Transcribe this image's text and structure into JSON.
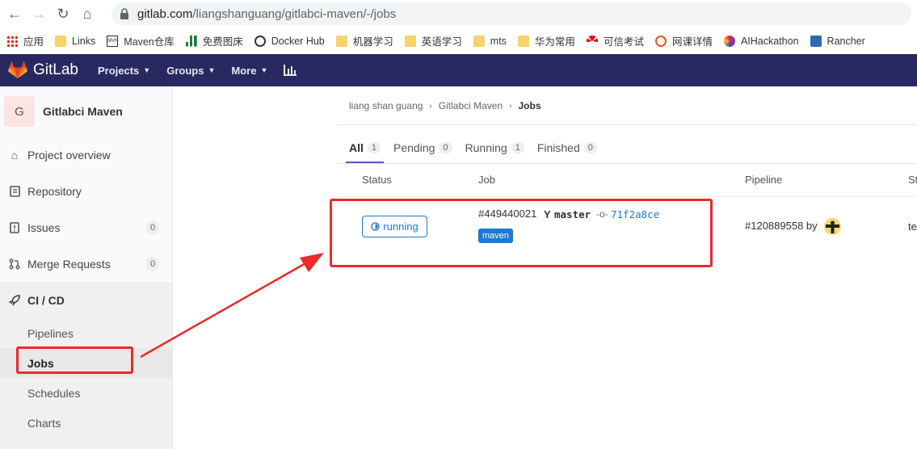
{
  "browser": {
    "url_host": "gitlab.com",
    "url_path": "/liangshanguang/gitlabci-maven/-/jobs",
    "bookmarks": [
      {
        "label": "应用",
        "icon": "apps-grid-icon"
      },
      {
        "label": "Links",
        "icon": "folder-icon"
      },
      {
        "label": "Maven仓库",
        "icon": "mvn-icon"
      },
      {
        "label": "免费图床",
        "icon": "chart-icon"
      },
      {
        "label": "Docker Hub",
        "icon": "docker-icon"
      },
      {
        "label": "机器学习",
        "icon": "folder-icon"
      },
      {
        "label": "英语学习",
        "icon": "folder-icon"
      },
      {
        "label": "mts",
        "icon": "folder-icon"
      },
      {
        "label": "华为常用",
        "icon": "folder-icon"
      },
      {
        "label": "可信考试",
        "icon": "huawei-icon"
      },
      {
        "label": "网课详情",
        "icon": "apple-icon"
      },
      {
        "label": "AIHackathon",
        "icon": "ai-icon"
      },
      {
        "label": "Rancher",
        "icon": "rancher-icon"
      }
    ]
  },
  "header": {
    "brand": "GitLab",
    "nav": [
      "Projects",
      "Groups",
      "More"
    ]
  },
  "sidebar": {
    "avatar_letter": "G",
    "project_name": "Gitlabci Maven",
    "items": [
      {
        "label": "Project overview"
      },
      {
        "label": "Repository"
      },
      {
        "label": "Issues",
        "count": "0"
      },
      {
        "label": "Merge Requests",
        "count": "0"
      }
    ],
    "cicd": {
      "label": "CI / CD",
      "subitems": [
        "Pipelines",
        "Jobs",
        "Schedules",
        "Charts"
      ]
    }
  },
  "breadcrumb": [
    "liang shan guang",
    "Gitlabci Maven",
    "Jobs"
  ],
  "tabs": [
    {
      "label": "All",
      "count": "1"
    },
    {
      "label": "Pending",
      "count": "0"
    },
    {
      "label": "Running",
      "count": "1"
    },
    {
      "label": "Finished",
      "count": "0"
    }
  ],
  "table": {
    "headers": [
      "Status",
      "Job",
      "Pipeline",
      "St"
    ],
    "row": {
      "status": "running",
      "job_id": "#449440021",
      "branch": "master",
      "commit": "71f2a8ce",
      "tag": "maven",
      "pipeline": "#120889558 by",
      "stage": "te"
    }
  },
  "colors": {
    "header_bg": "#292961",
    "accent": "#1f78d1",
    "annotation": "#ec2a2a"
  }
}
